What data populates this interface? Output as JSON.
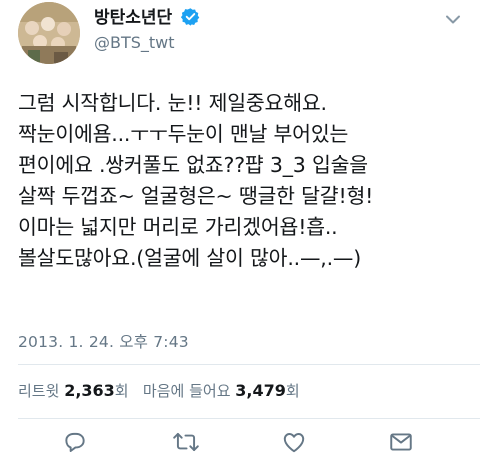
{
  "header": {
    "display_name": "방탄소년단",
    "handle": "@BTS_twt",
    "verified_icon": "verified-badge-icon",
    "menu_icon": "chevron-down-icon"
  },
  "tweet": {
    "lines": [
      "그럼 시작합니다. 눈!! 제일중요해요.",
      "짝눈이에욤...ㅜㅜ두눈이 맨날 부어있는",
      "편이에요 .쌍커풀도 없죠??퍕 3_3 입술을",
      "살짝 두껍죠~ 얼굴형은~ 땡글한 달걀!형!",
      "이마는 넓지만 머리로 가리겠어욥!흡..",
      "볼살도많아요.(얼굴에 살이 많아..—,.—)"
    ],
    "timestamp": "2013. 1. 24. 오후 7:43"
  },
  "stats": {
    "retweets_label": "리트윗",
    "retweets_count": "2,363",
    "retweets_unit": "회",
    "likes_label": "마음에 들어요",
    "likes_count": "3,479",
    "likes_unit": "회"
  },
  "actions": {
    "icons": [
      "reply-icon",
      "retweet-icon",
      "like-icon",
      "share-icon"
    ]
  },
  "colors": {
    "accent": "#1da1f2",
    "text": "#14171a",
    "muted": "#657786",
    "divider": "#e1e8ed"
  }
}
